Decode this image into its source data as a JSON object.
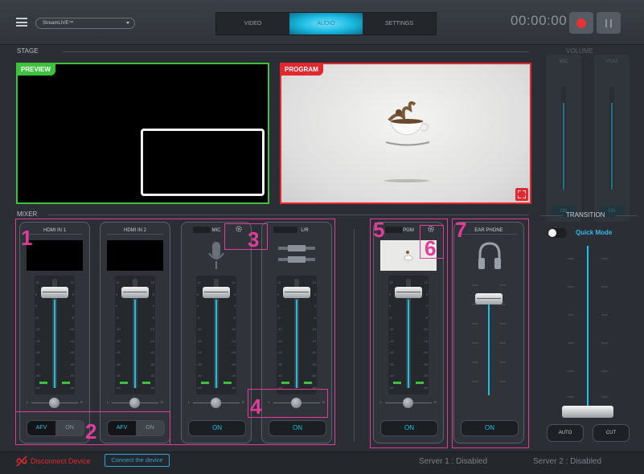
{
  "app": {
    "account_name": "StreamLIVE™",
    "tabs": [
      {
        "label": "VIDEO",
        "active": false
      },
      {
        "label": "AUDIO",
        "active": true
      },
      {
        "label": "SETTINGS",
        "active": false
      }
    ],
    "timer": "00:00:00"
  },
  "stage": {
    "label": "STAGE",
    "preview_label": "PREVIEW",
    "program_label": "PROGRAM"
  },
  "volume": {
    "label": "VOLUME",
    "channels": [
      {
        "label": "MIC",
        "on_label": "ON"
      },
      {
        "label": "PGM",
        "on_label": "ON"
      }
    ]
  },
  "mixer": {
    "label": "MIXER",
    "channels": [
      {
        "name": "HDMI IN 1",
        "afv_label": "AFV",
        "on_label": "ON"
      },
      {
        "name": "HDMI IN 2",
        "afv_label": "AFV",
        "on_label": "ON"
      },
      {
        "name": "MIC",
        "on_label": "ON"
      },
      {
        "name": "L/R",
        "on_label": "ON"
      },
      {
        "name": "PGM",
        "on_label": "ON"
      },
      {
        "name": "EAR PHONE",
        "on_label": "ON"
      }
    ],
    "scale_ticks": [
      "10",
      "5",
      "0",
      "-5",
      "-10",
      "-15",
      "-20",
      "-30",
      "-40",
      "-inf"
    ],
    "bal_left": "L",
    "bal_right": "R"
  },
  "transition": {
    "label": "TRANSITION",
    "quick_mode_label": "Quick Mode",
    "auto_label": "AUTO",
    "cut_label": "CUT"
  },
  "status": {
    "disconnect_text": "Disconnect Device",
    "connect_button": "Connect the device",
    "server1": "Server 1 :  Disabled",
    "server2": "Server 2 :  Disabled"
  },
  "annotations": [
    "1",
    "2",
    "3",
    "4",
    "5",
    "6",
    "7"
  ],
  "colors": {
    "accent": "#19c2de",
    "preview": "#3ec23e",
    "program": "#e3282f",
    "annotation": "#e23c9a"
  }
}
